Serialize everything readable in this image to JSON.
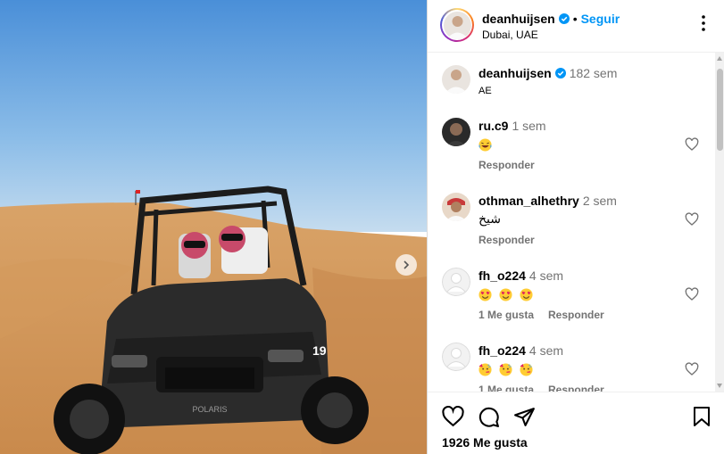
{
  "post": {
    "username": "deanhuijsen",
    "follow_label": "Seguir",
    "location": "Dubai, UAE",
    "dot": "•"
  },
  "caption": {
    "username": "deanhuijsen",
    "time": "182 sem",
    "text": "AE"
  },
  "comments": [
    {
      "username": "ru.c9",
      "time": "1 sem",
      "text": "",
      "emojis": [
        "laughing"
      ],
      "actions": [
        "Responder"
      ]
    },
    {
      "username": "othman_alhethry",
      "time": "2 sem",
      "text": "شيخ",
      "emojis": [],
      "actions": [
        "Responder"
      ]
    },
    {
      "username": "fh_o224",
      "time": "4 sem",
      "text": "",
      "emojis": [
        "heart-eyes",
        "heart-eyes",
        "heart-eyes"
      ],
      "actions": [
        "1 Me gusta",
        "Responder"
      ]
    },
    {
      "username": "fh_o224",
      "time": "4 sem",
      "text": "",
      "emojis": [
        "party",
        "party",
        "party"
      ],
      "actions": [
        "1 Me gusta",
        "Responder"
      ]
    }
  ],
  "footer": {
    "likes": "1926 Me gusta"
  },
  "colors": {
    "accent": "#0095f6",
    "verified": "#0095f6",
    "muted": "#737373"
  },
  "icons": [
    "verified-badge-icon",
    "more-options-icon",
    "heart-icon",
    "comment-icon",
    "share-icon",
    "bookmark-icon",
    "chevron-right-icon"
  ]
}
